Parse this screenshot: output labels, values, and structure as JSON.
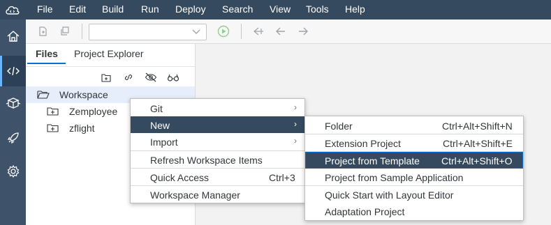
{
  "menubar": {
    "items": [
      "File",
      "Edit",
      "Build",
      "Run",
      "Deploy",
      "Search",
      "View",
      "Tools",
      "Help"
    ]
  },
  "sidebar": {
    "items": [
      "home-icon",
      "code-icon",
      "packages-icon",
      "rocket-icon",
      "settings-icon"
    ],
    "active": "code-icon"
  },
  "toolbar": {
    "icons": [
      "new-file-icon",
      "new-window-icon",
      "run-icon",
      "deploy-back-icon",
      "back-icon",
      "forward-icon"
    ],
    "run_config_value": ""
  },
  "panel": {
    "tabs": [
      "Files",
      "Project Explorer"
    ],
    "active_tab": "Files",
    "actions": [
      "new-folder-icon",
      "link-icon",
      "hide-icon",
      "search-glasses-icon"
    ],
    "tree": [
      {
        "label": "Workspace",
        "icon": "folder-open-icon"
      },
      {
        "label": "Zemployee",
        "icon": "project-folder-icon"
      },
      {
        "label": "zflight",
        "icon": "project-folder-icon"
      }
    ]
  },
  "context_menu": {
    "items": [
      {
        "label": "Git",
        "shortcut": "",
        "submenu": true
      },
      {
        "label": "New",
        "shortcut": "",
        "submenu": true
      },
      {
        "label": "Import",
        "shortcut": "",
        "submenu": true
      },
      {
        "label": "Refresh Workspace Items",
        "shortcut": ""
      },
      {
        "label": "Quick Access",
        "shortcut": "Ctrl+3"
      },
      {
        "label": "Workspace Manager",
        "shortcut": ""
      }
    ]
  },
  "submenu": {
    "items": [
      {
        "label": "Folder",
        "shortcut": "Ctrl+Alt+Shift+N"
      },
      {
        "label": "Extension Project",
        "shortcut": "Ctrl+Alt+Shift+E"
      },
      {
        "label": "Project from Template",
        "shortcut": "Ctrl+Alt+Shift+O"
      },
      {
        "label": "Project from Sample Application",
        "shortcut": ""
      },
      {
        "label": "Quick Start with Layout Editor",
        "shortcut": ""
      },
      {
        "label": "Adaptation Project",
        "shortcut": ""
      }
    ]
  },
  "colors": {
    "menubar": "#354a5f",
    "sidebar": "#3e5369",
    "accent": "#0a6ed1",
    "highlight": "#354a5f"
  }
}
